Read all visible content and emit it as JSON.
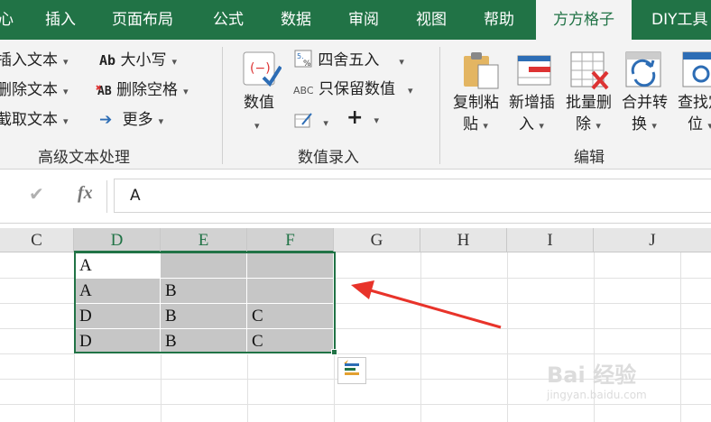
{
  "ribbon_tabs": [
    {
      "label": "心"
    },
    {
      "label": "插入"
    },
    {
      "label": "页面布局"
    },
    {
      "label": "公式"
    },
    {
      "label": "数据"
    },
    {
      "label": "审阅"
    },
    {
      "label": "视图"
    },
    {
      "label": "帮助"
    },
    {
      "label": "方方格子",
      "active": true
    },
    {
      "label": "DIY工具"
    }
  ],
  "groups": {
    "text": {
      "label": "高级文本处理",
      "items": [
        "插入文本",
        "删除文本",
        "截取文本"
      ],
      "case_label": "大小写",
      "case_icon_text": "Ab",
      "remove_spaces_label": "删除空格",
      "remove_spaces_icon_text": "AB",
      "more_label": "更多"
    },
    "number": {
      "label": "数值录入",
      "value_button": "数值",
      "round_label": "四舍五入",
      "keep_value_label": "只保留数值",
      "keep_value_icon_text": "ABC",
      "plus_symbol": "+"
    },
    "edit": {
      "label": "编辑",
      "buttons": [
        {
          "line1": "复制粘",
          "line2": "贴"
        },
        {
          "line1": "新增插",
          "line2": "入"
        },
        {
          "line1": "批量删",
          "line2": "除"
        },
        {
          "line1": "合并转",
          "line2": "换"
        },
        {
          "line1": "查找定",
          "line2": "位"
        }
      ]
    }
  },
  "formula_bar": {
    "check_symbol": "✔",
    "fx_symbol": "fx",
    "value": "A"
  },
  "columns": [
    "C",
    "D",
    "E",
    "F",
    "G",
    "H",
    "I",
    "J"
  ],
  "selected_columns": [
    "D",
    "E",
    "F"
  ],
  "cells": [
    [
      "A",
      "",
      ""
    ],
    [
      "A",
      "B",
      ""
    ],
    [
      "D",
      "B",
      "C"
    ],
    [
      "D",
      "B",
      "C"
    ]
  ],
  "annotation": {
    "color": "#e8332a"
  },
  "watermark": {
    "text": "Bai 经验",
    "sub": "jingyan.baidu.com"
  },
  "colors": {
    "accent": "#217346",
    "selection_fill": "#c6c6c6"
  }
}
